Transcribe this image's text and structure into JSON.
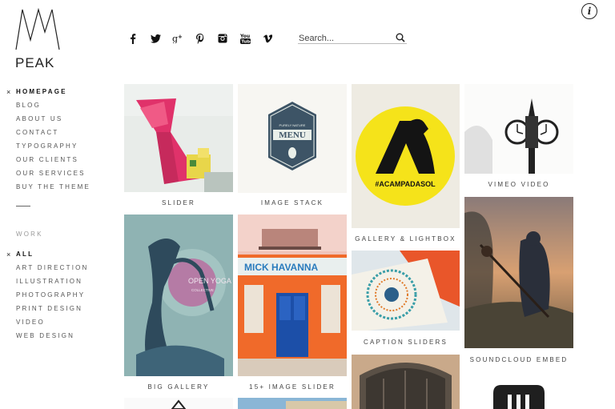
{
  "logo": {
    "text": "PEAK"
  },
  "header": {
    "search_placeholder": "Search...",
    "info_glyph": "i",
    "social_icons": [
      "facebook-icon",
      "twitter-icon",
      "google-plus-icon",
      "pinterest-icon",
      "instagram-icon",
      "youtube-icon",
      "vimeo-icon"
    ]
  },
  "nav": {
    "items": [
      {
        "label": "HOMEPAGE",
        "active": true
      },
      {
        "label": "BLOG"
      },
      {
        "label": "ABOUT US"
      },
      {
        "label": "CONTACT"
      },
      {
        "label": "TYPOGRAPHY"
      },
      {
        "label": "OUR CLIENTS"
      },
      {
        "label": "OUR SERVICES"
      },
      {
        "label": "BUY THE THEME"
      }
    ],
    "active_marker": "×"
  },
  "work": {
    "label": "WORK",
    "items": [
      {
        "label": "ALL",
        "active": true
      },
      {
        "label": "ART DIRECTION"
      },
      {
        "label": "ILLUSTRATION"
      },
      {
        "label": "PHOTOGRAPHY"
      },
      {
        "label": "PRINT DESIGN"
      },
      {
        "label": "VIDEO"
      },
      {
        "label": "WEB DESIGN"
      }
    ]
  },
  "portfolio": {
    "captions": {
      "slider": "SLIDER",
      "image_stack": "IMAGE STACK",
      "gallery_lightbox": "GALLERY & LIGHTBOX",
      "vimeo_video": "VIMEO VIDEO",
      "big_gallery": "BIG GALLERY",
      "image_slider": "15+ IMAGE SLIDER",
      "caption_sliders": "CAPTION SLIDERS",
      "soundcloud_embed": "SOUNDCLOUD EMBED"
    },
    "image_text": {
      "menu_badge_top": "PURELY NATURE",
      "menu_badge_word": "MENU",
      "acampada": "#ACAMPADASOL",
      "open_yoga": "OPEN YOGA",
      "open_yoga_sub": "COLLECTIVE",
      "storefront": "MICK HAVANNA"
    }
  }
}
